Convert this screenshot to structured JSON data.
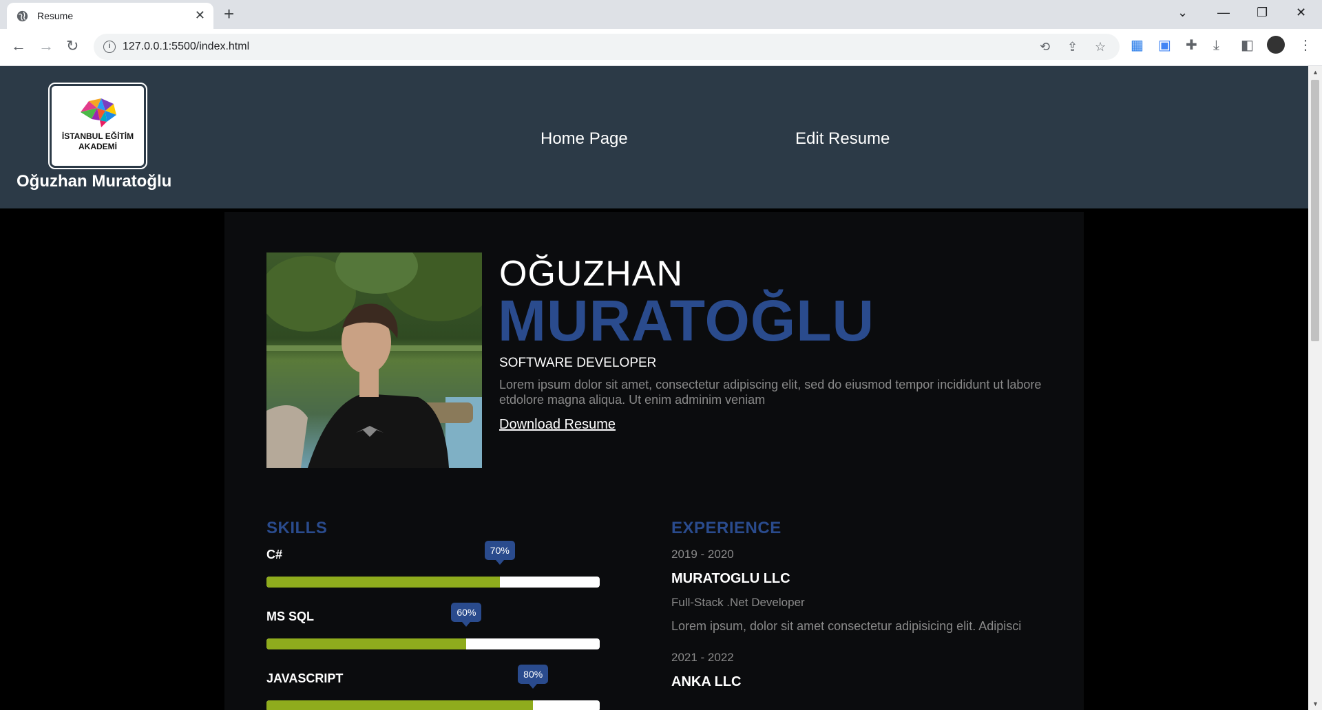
{
  "browser": {
    "tab_title": "Resume",
    "url": "127.0.0.1:5500/index.html"
  },
  "header": {
    "logo_text_line1": "İSTANBUL EĞİTİM",
    "logo_text_line2": "AKADEMİ",
    "site_name": "Oğuzhan Muratoğlu",
    "nav": [
      "Home Page",
      "Edit Resume"
    ]
  },
  "profile": {
    "first_name": "OĞUZHAN",
    "last_name": "MURATOĞLU",
    "role": "SOFTWARE DEVELOPER",
    "bio": "Lorem ipsum dolor sit amet, consectetur adipiscing elit, sed do eiusmod tempor incididunt ut labore etdolore magna aliqua. Ut enim adminim veniam",
    "download_label": "Download Resume"
  },
  "skills": {
    "title": "SKILLS",
    "items": [
      {
        "name": "C#",
        "percent": 70,
        "label": "70%"
      },
      {
        "name": "MS SQL",
        "percent": 60,
        "label": "60%"
      },
      {
        "name": "JAVASCRIPT",
        "percent": 80,
        "label": "80%"
      }
    ]
  },
  "experience": {
    "title": "EXPERIENCE",
    "items": [
      {
        "date": "2019 - 2020",
        "company": "MURATOGLU LLC",
        "role": "Full-Stack .Net Developer",
        "desc": "Lorem ipsum, dolor sit amet consectetur adipisicing elit. Adipisci"
      },
      {
        "date": "2021 - 2022",
        "company": "ANKA LLC"
      }
    ]
  },
  "colors": {
    "header_bg": "#2c3a47",
    "accent_blue": "#2a4b8d",
    "bar_green": "#8fac1d",
    "page_bg": "#000000",
    "content_bg": "#0b0c0e"
  }
}
